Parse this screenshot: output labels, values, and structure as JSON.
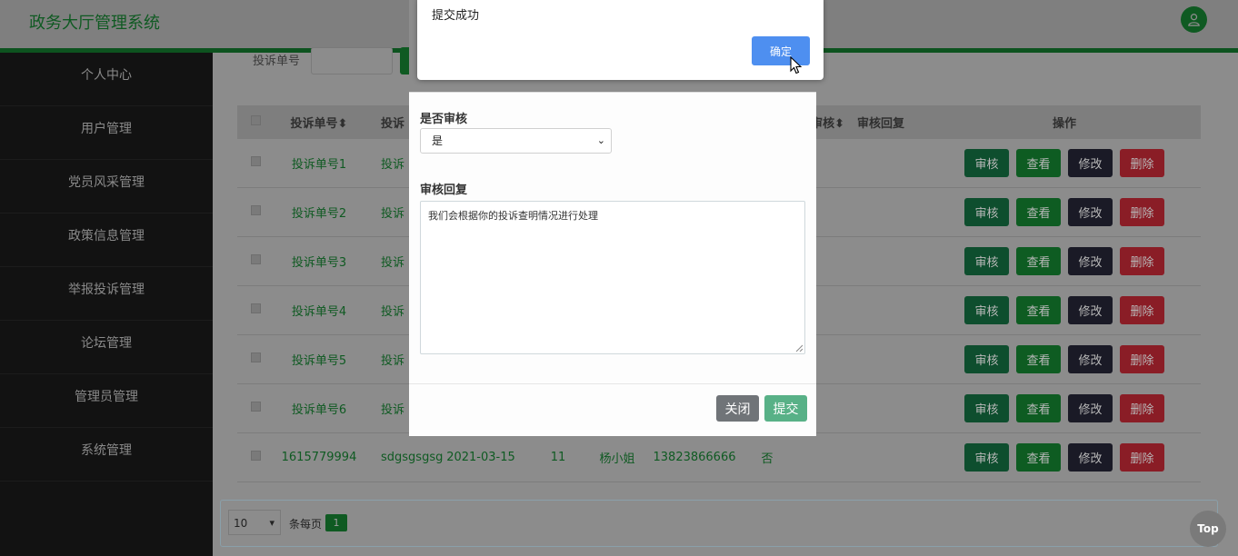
{
  "app": {
    "title": "政务大厅管理系统"
  },
  "sidebar": {
    "items": [
      {
        "label": "个人中心"
      },
      {
        "label": "用户管理"
      },
      {
        "label": "党员风采管理"
      },
      {
        "label": "政策信息管理"
      },
      {
        "label": "举报投诉管理"
      },
      {
        "label": "论坛管理"
      },
      {
        "label": "管理员管理"
      },
      {
        "label": "系统管理"
      }
    ]
  },
  "search": {
    "label": "投诉单号"
  },
  "table": {
    "headers": {
      "no": "投诉单号",
      "name_partial": "投诉",
      "audit_partial": "审核",
      "reply": "审核回复",
      "ops": "操作"
    },
    "rows": [
      {
        "no": "投诉单号1",
        "name": "投诉",
        "date": "",
        "num": "",
        "person": "",
        "phone": "",
        "audit": ""
      },
      {
        "no": "投诉单号2",
        "name": "投诉",
        "date": "",
        "num": "",
        "person": "",
        "phone": "",
        "audit": ""
      },
      {
        "no": "投诉单号3",
        "name": "投诉",
        "date": "",
        "num": "",
        "person": "",
        "phone": "",
        "audit": ""
      },
      {
        "no": "投诉单号4",
        "name": "投诉",
        "date": "",
        "num": "",
        "person": "",
        "phone": "",
        "audit": ""
      },
      {
        "no": "投诉单号5",
        "name": "投诉",
        "date": "",
        "num": "",
        "person": "",
        "phone": "",
        "audit": ""
      },
      {
        "no": "投诉单号6",
        "name": "投诉",
        "date": "",
        "num": "",
        "person": "",
        "phone": "",
        "audit": ""
      },
      {
        "no": "1615779994",
        "name": "sdgsgsgsg",
        "date": "2021-03-15",
        "num": "11",
        "person": "杨小姐",
        "phone": "13823866666",
        "audit": "否"
      }
    ],
    "actions": {
      "audit": "审核",
      "view": "查看",
      "edit": "修改",
      "delete": "删除"
    }
  },
  "pagination": {
    "page_size": "10",
    "per_page_label": "条每页",
    "current_page": "1"
  },
  "top_button": "Top",
  "modal": {
    "audit_label": "是否审核",
    "audit_value": "是",
    "reply_label": "审核回复",
    "reply_value": "我们会根据你的投诉查明情况进行处理",
    "close_label": "关闭",
    "submit_label": "提交"
  },
  "alert": {
    "message": "提交成功",
    "ok_label": "确定"
  },
  "colors": {
    "primary_green": "#1e9b44",
    "dark_green": "#0d531f",
    "alert_button": "#4e8ff0",
    "delete_red": "#d9374a",
    "edit_dark": "#343a40"
  }
}
